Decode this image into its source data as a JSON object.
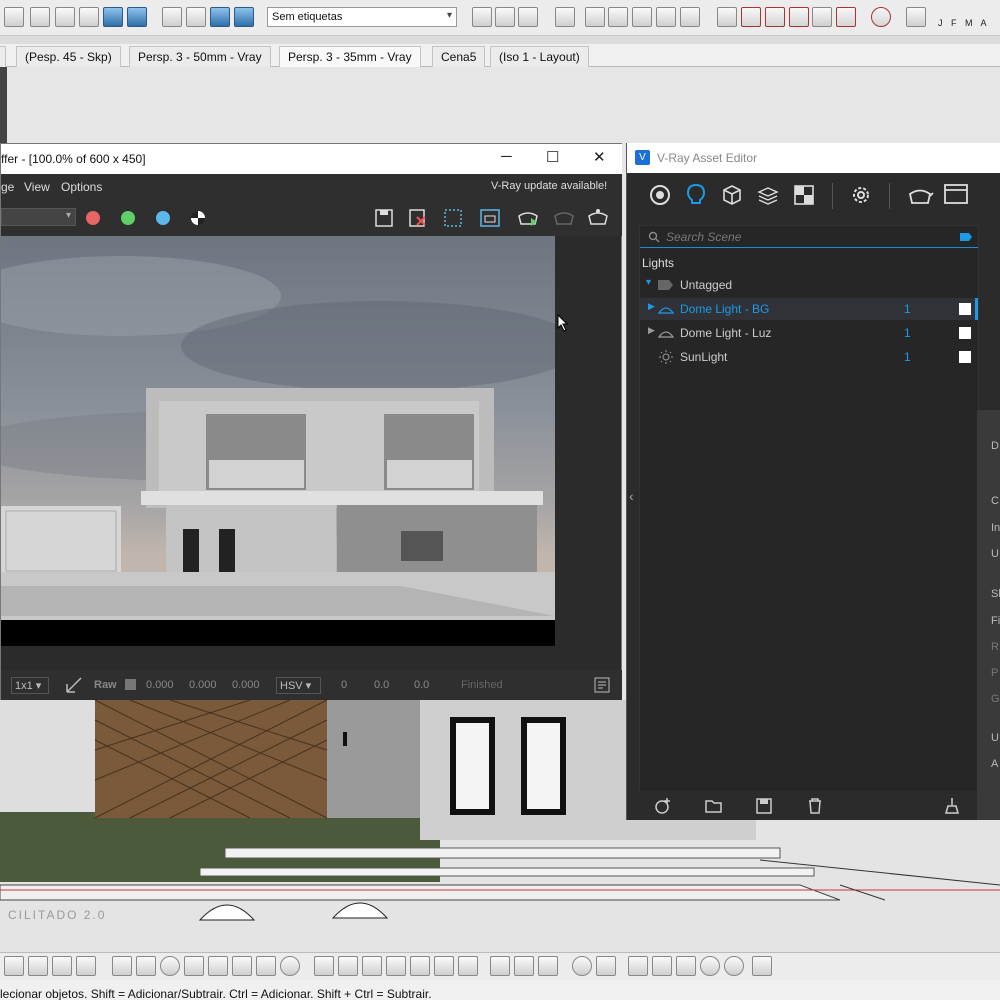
{
  "toolbar": {
    "tag_select_value": "Sem etiquetas",
    "calendar_months": "J F M A"
  },
  "scene_tabs": [
    {
      "label": "(Pesp. 45 - Skp)"
    },
    {
      "label": "Persp. 3 - 50mm - Vray"
    },
    {
      "label": "Persp. 3 - 35mm - Vray",
      "active": true
    },
    {
      "label": "Cena5"
    },
    {
      "label": "(Iso 1 - Layout)"
    }
  ],
  "vfb": {
    "title": "ffer - [100.0% of 600 x 450]",
    "menu": [
      "ge",
      "View",
      "Options"
    ],
    "update_notice": "V-Ray update available!",
    "status": {
      "zoom": "1x1",
      "raw_label": "Raw",
      "r": "0.000",
      "g": "0.000",
      "b": "0.000",
      "color_mode": "HSV",
      "h": "0",
      "s": "0.0",
      "v": "0.0",
      "state": "Finished"
    }
  },
  "asset_editor": {
    "title": "V-Ray Asset Editor",
    "search_placeholder": "Search Scene",
    "section": "Lights",
    "group": "Untagged",
    "lights": [
      {
        "name": "Dome Light - BG",
        "count": "1",
        "selected": true
      },
      {
        "name": "Dome Light - Luz",
        "count": "1"
      },
      {
        "name": "SunLight",
        "count": "1"
      }
    ],
    "side_panel_letters": [
      "D",
      "C",
      "In",
      "U",
      "Sl",
      "Fi",
      "R",
      "P",
      "G",
      "U",
      "A"
    ]
  },
  "viewport": {
    "watermark": "CILITADO 2.0"
  },
  "statusbar": {
    "hint": "lecionar objetos. Shift = Adicionar/Subtrair. Ctrl = Adicionar. Shift + Ctrl = Subtrair."
  },
  "colors": {
    "accent": "#1a9be8",
    "vfb_bg": "#2b2b2b",
    "dot_red": "#e86565",
    "dot_green": "#5fcf6a",
    "dot_blue": "#5bb8ea"
  }
}
